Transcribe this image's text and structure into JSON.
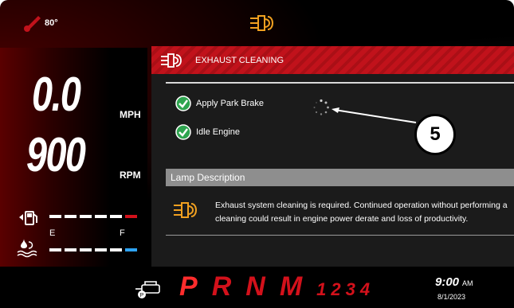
{
  "top": {
    "temperature": "80°",
    "icons": {
      "temperature": "coolant-temp-icon",
      "status": "exhaust-cleaning-icon"
    }
  },
  "left": {
    "speed_value": "0.0",
    "speed_unit": "MPH",
    "rpm_value": "900",
    "rpm_unit": "RPM",
    "fuel_label_e": "E",
    "fuel_label_f": "F",
    "fuel_level_fraction": 0.9,
    "def_level_fraction": 0.95
  },
  "panel": {
    "title": "EXHAUST CLEANING",
    "steps": [
      {
        "label": "Apply Park Brake",
        "done": true
      },
      {
        "label": "Idle Engine",
        "done": true
      }
    ],
    "lamp_header": "Lamp Description",
    "lamp_desc": "Exhaust system cleaning is required. Continued operation without performing a cleaning could result in engine power derate and loss of productivity."
  },
  "callout": {
    "number": "5"
  },
  "bottom": {
    "gears": [
      "P",
      "R",
      "N",
      "M"
    ],
    "manual_gears": [
      "1",
      "2",
      "3",
      "4"
    ],
    "time": "9:00",
    "ampm": "AM",
    "date": "8/1/2023"
  },
  "colors": {
    "accent_red": "#c1121b",
    "icon_orange": "#f0a020",
    "check_green": "#2ea44f",
    "def_blue": "#2ea3f2"
  }
}
